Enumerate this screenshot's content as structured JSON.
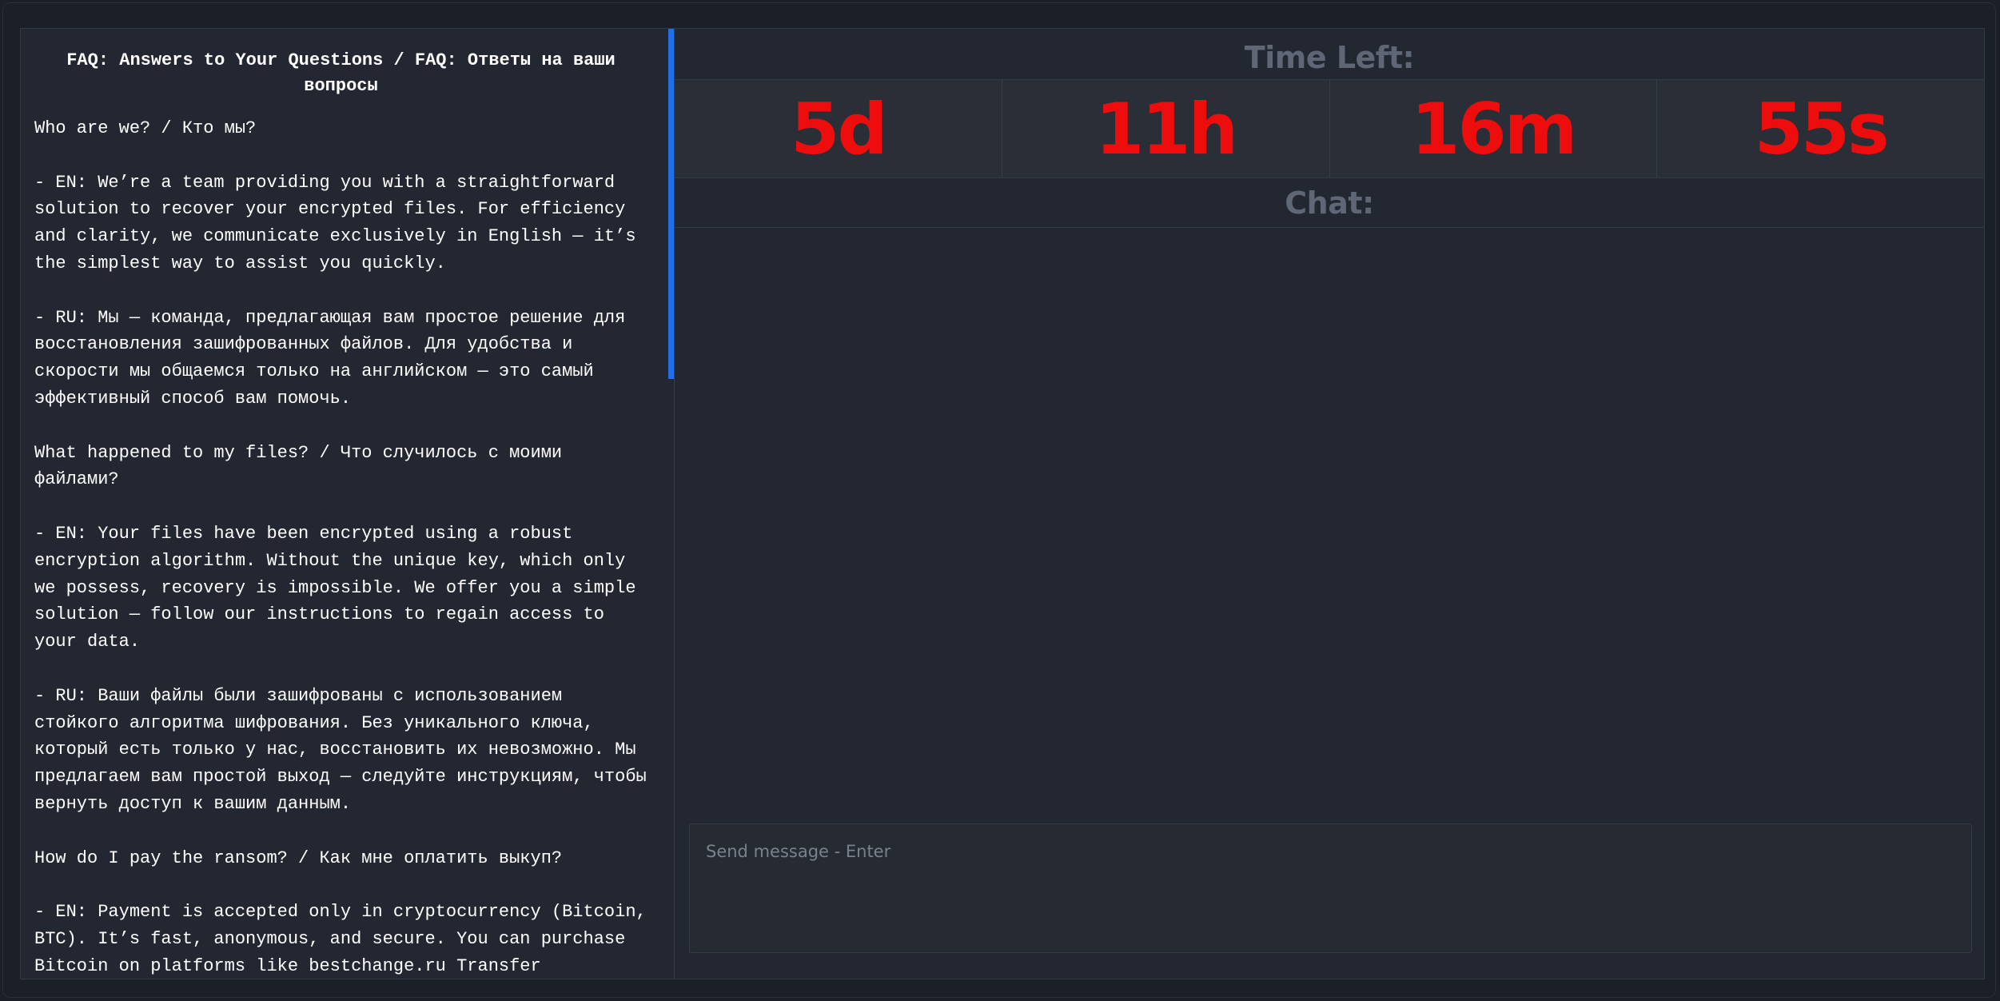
{
  "faq": {
    "title": "FAQ: Answers to Your Questions / FAQ: Ответы на ваши вопросы",
    "paragraphs": [
      "Who are we? / Кто мы?",
      "- EN: We’re a team providing you with a straightforward solution to recover your encrypted files. For efficiency and clarity, we communicate exclusively in English — it’s the simplest way to assist you quickly.",
      "- RU: Мы — команда, предлагающая вам простое решение для восстановления зашифрованных файлов. Для удобства и скорости мы общаемся только на английском — это самый эффективный способ вам помочь.",
      "What happened to my files? / Что случилось с моими файлами?",
      "- EN: Your files have been encrypted using a robust encryption algorithm. Without the unique key, which only we possess, recovery is impossible. We offer you a simple solution — follow our instructions to regain access to your data.",
      "- RU: Ваши файлы были зашифрованы с использованием стойкого алгоритма шифрования. Без уникального ключа, который есть только у нас, восстановить их невозможно. Мы предлагаем вам простой выход — следуйте инструкциям, чтобы вернуть доступ к вашим данным.",
      "How do I pay the ransom? / Как мне оплатить выкуп?",
      "- EN: Payment is accepted only in cryptocurrency (Bitcoin, BTC). It’s fast, anonymous, and secure. You can purchase Bitcoin on platforms like bestchange.ru Transfer instructions will follow."
    ]
  },
  "timer": {
    "label": "Time Left:",
    "days": "5d",
    "hours": "11h",
    "minutes": "16m",
    "seconds": "55s"
  },
  "chat": {
    "label": "Chat:",
    "input_placeholder": "Send message - Enter",
    "input_value": ""
  },
  "colors": {
    "timer_digits": "#ee0d0d",
    "scrollbar_thumb": "#1f6fe6",
    "label_gray": "#5f6675"
  }
}
